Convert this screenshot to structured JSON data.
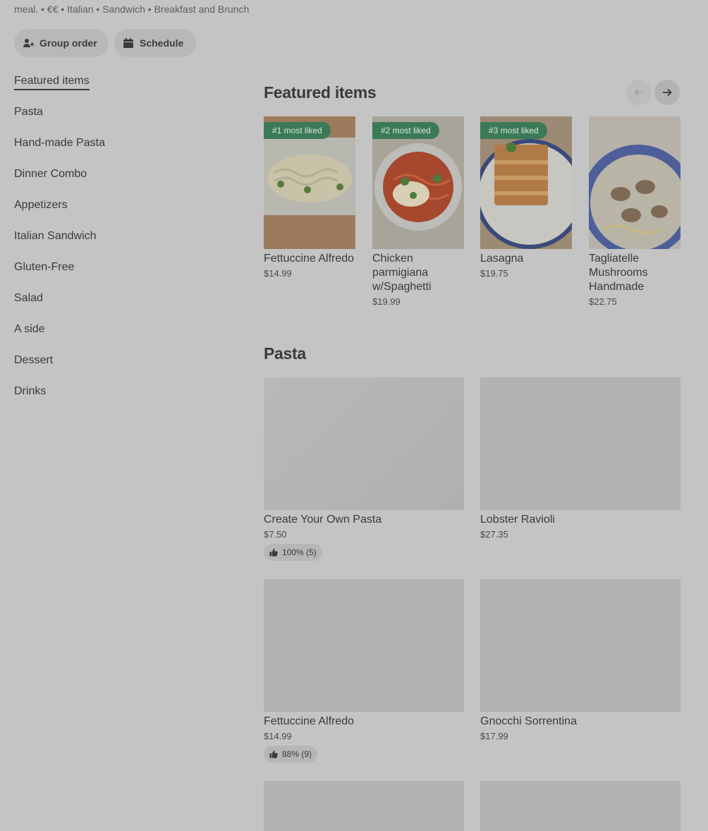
{
  "header": {
    "subtitle": "meal. • €€ • Italian • Sandwich • Breakfast and Brunch",
    "group_order_label": "Group order",
    "schedule_label": "Schedule"
  },
  "sidebar": {
    "items": [
      {
        "label": "Featured items"
      },
      {
        "label": "Pasta"
      },
      {
        "label": "Hand-made Pasta"
      },
      {
        "label": "Dinner Combo"
      },
      {
        "label": "Appetizers"
      },
      {
        "label": "Italian Sandwich"
      },
      {
        "label": "Gluten-Free"
      },
      {
        "label": "Salad"
      },
      {
        "label": "A side"
      },
      {
        "label": "Dessert"
      },
      {
        "label": "Drinks"
      }
    ]
  },
  "featured": {
    "title": "Featured items",
    "items": [
      {
        "badge": "#1 most liked",
        "name": "Fettuccine Alfredo",
        "price": "$14.99"
      },
      {
        "badge": "#2 most liked",
        "name": "Chicken parmigiana w/Spaghetti",
        "price": "$19.99"
      },
      {
        "badge": "#3 most liked",
        "name": "Lasagna",
        "price": "$19.75"
      },
      {
        "badge": "",
        "name": "Tagliatelle Mushrooms Handmade",
        "price": "$22.75"
      }
    ]
  },
  "pasta": {
    "title": "Pasta",
    "items": [
      {
        "name": "Create Your Own Pasta",
        "price": "$7.50",
        "rating": "100% (5)"
      },
      {
        "name": "Lobster Ravioli",
        "price": "$27.35",
        "rating": ""
      },
      {
        "name": "Fettuccine Alfredo",
        "price": "$14.99",
        "rating": "88% (9)"
      },
      {
        "name": "Gnocchi Sorrentina",
        "price": "$17.99",
        "rating": ""
      }
    ]
  },
  "colors": {
    "overlay": "#c4c4c4",
    "badge_green": "#3c7a57"
  }
}
